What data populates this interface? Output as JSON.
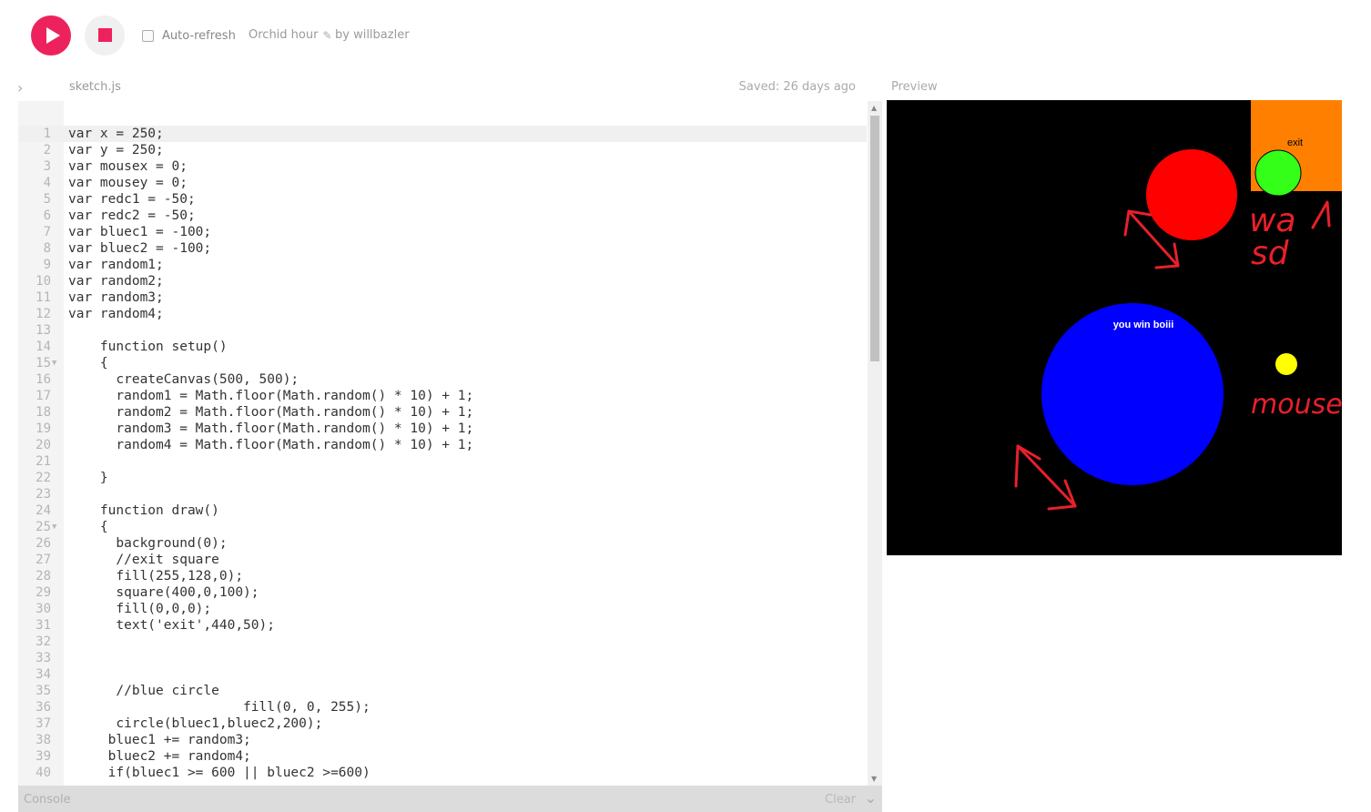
{
  "toolbar": {
    "play_label": "Play",
    "stop_label": "Stop",
    "autorefresh_label": "Auto-refresh",
    "sketch_title": "Orchid hour",
    "byline": "by willbazler"
  },
  "editor": {
    "filename": "sketch.js",
    "saved_status": "Saved: 26 days ago",
    "lines": [
      "var x = 250;",
      "var y = 250;",
      "var mousex = 0;",
      "var mousey = 0;",
      "var redc1 = -50;",
      "var redc2 = -50;",
      "var bluec1 = -100;",
      "var bluec2 = -100;",
      "var random1;",
      "var random2;",
      "var random3;",
      "var random4;",
      "",
      "    function setup()",
      "    {",
      "      createCanvas(500, 500);",
      "      random1 = Math.floor(Math.random() * 10) + 1;",
      "      random2 = Math.floor(Math.random() * 10) + 1;",
      "      random3 = Math.floor(Math.random() * 10) + 1;",
      "      random4 = Math.floor(Math.random() * 10) + 1;",
      "",
      "    }",
      "",
      "    function draw()",
      "    {",
      "      background(0);",
      "      //exit square",
      "      fill(255,128,0);",
      "      square(400,0,100);",
      "      fill(0,0,0);",
      "      text('exit',440,50);",
      "",
      "",
      "",
      "      //blue circle",
      "                      fill(0, 0, 255);",
      "      circle(bluec1,bluec2,200);",
      "     bluec1 += random3;",
      "     bluec2 += random4;",
      "     if(bluec1 >= 600 || bluec2 >=600)"
    ]
  },
  "console": {
    "label": "Console",
    "clear_label": "Clear"
  },
  "preview": {
    "label": "Preview",
    "exit_text": "exit",
    "win_text": "you win boiii",
    "annotation_keys_1": "wa",
    "annotation_keys_2": "sd",
    "annotation_mouse": "mouse",
    "colors": {
      "background": "#000000",
      "exit_square": "#ff8000",
      "green": "#33ff19",
      "red": "#ff0000",
      "blue": "#0000ff",
      "yellow": "#ffff00",
      "annotation": "#e8202a"
    }
  }
}
